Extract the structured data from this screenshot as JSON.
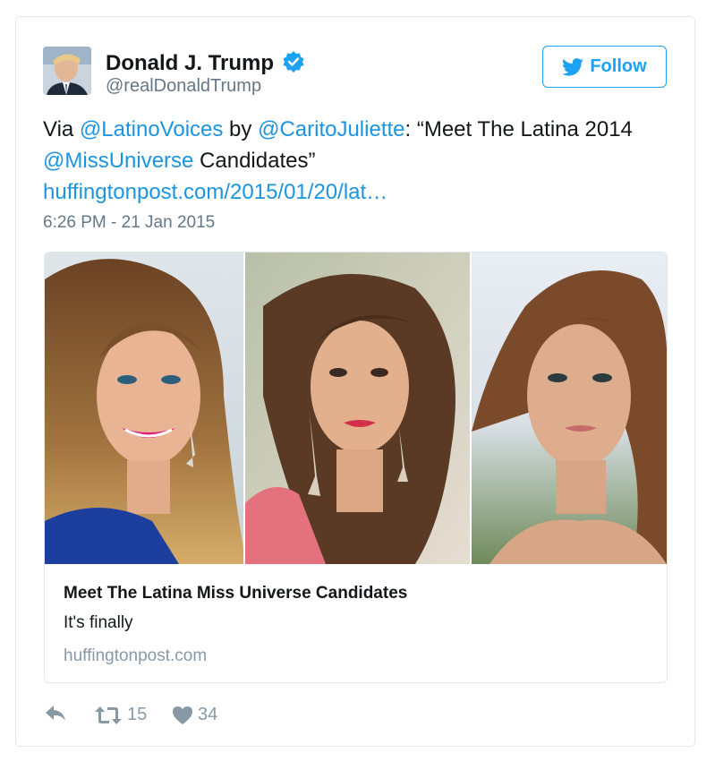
{
  "tweet": {
    "author_name": "Donald J. Trump",
    "author_handle": "@realDonaldTrump",
    "follow_label": "Follow",
    "text_prefix": "Via ",
    "mention_latino": "@LatinoVoices",
    "text_by": " by ",
    "mention_carito": "@CaritoJuliette",
    "text_quote": ": “Meet The Latina 2014 ",
    "mention_miss": "@MissUniverse",
    "text_suffix": " Candidates”",
    "link_text": "huffingtonpost.com/2015/01/20/lat…",
    "timestamp": "6:26 PM - 21 Jan 2015",
    "retweet_count": "15",
    "like_count": "34"
  },
  "card": {
    "title": "Meet The Latina Miss Universe Candidates",
    "description": "It's finally",
    "domain": "huffingtonpost.com"
  },
  "icons": {
    "verified": "verified-badge-icon",
    "follow": "twitter-bird-icon",
    "reply": "reply-icon",
    "retweet": "retweet-icon",
    "like": "heart-icon"
  },
  "colors": {
    "link": "#1b95e0",
    "accent": "#1da1f2",
    "muted": "#657786",
    "border": "#e1e8ed"
  }
}
